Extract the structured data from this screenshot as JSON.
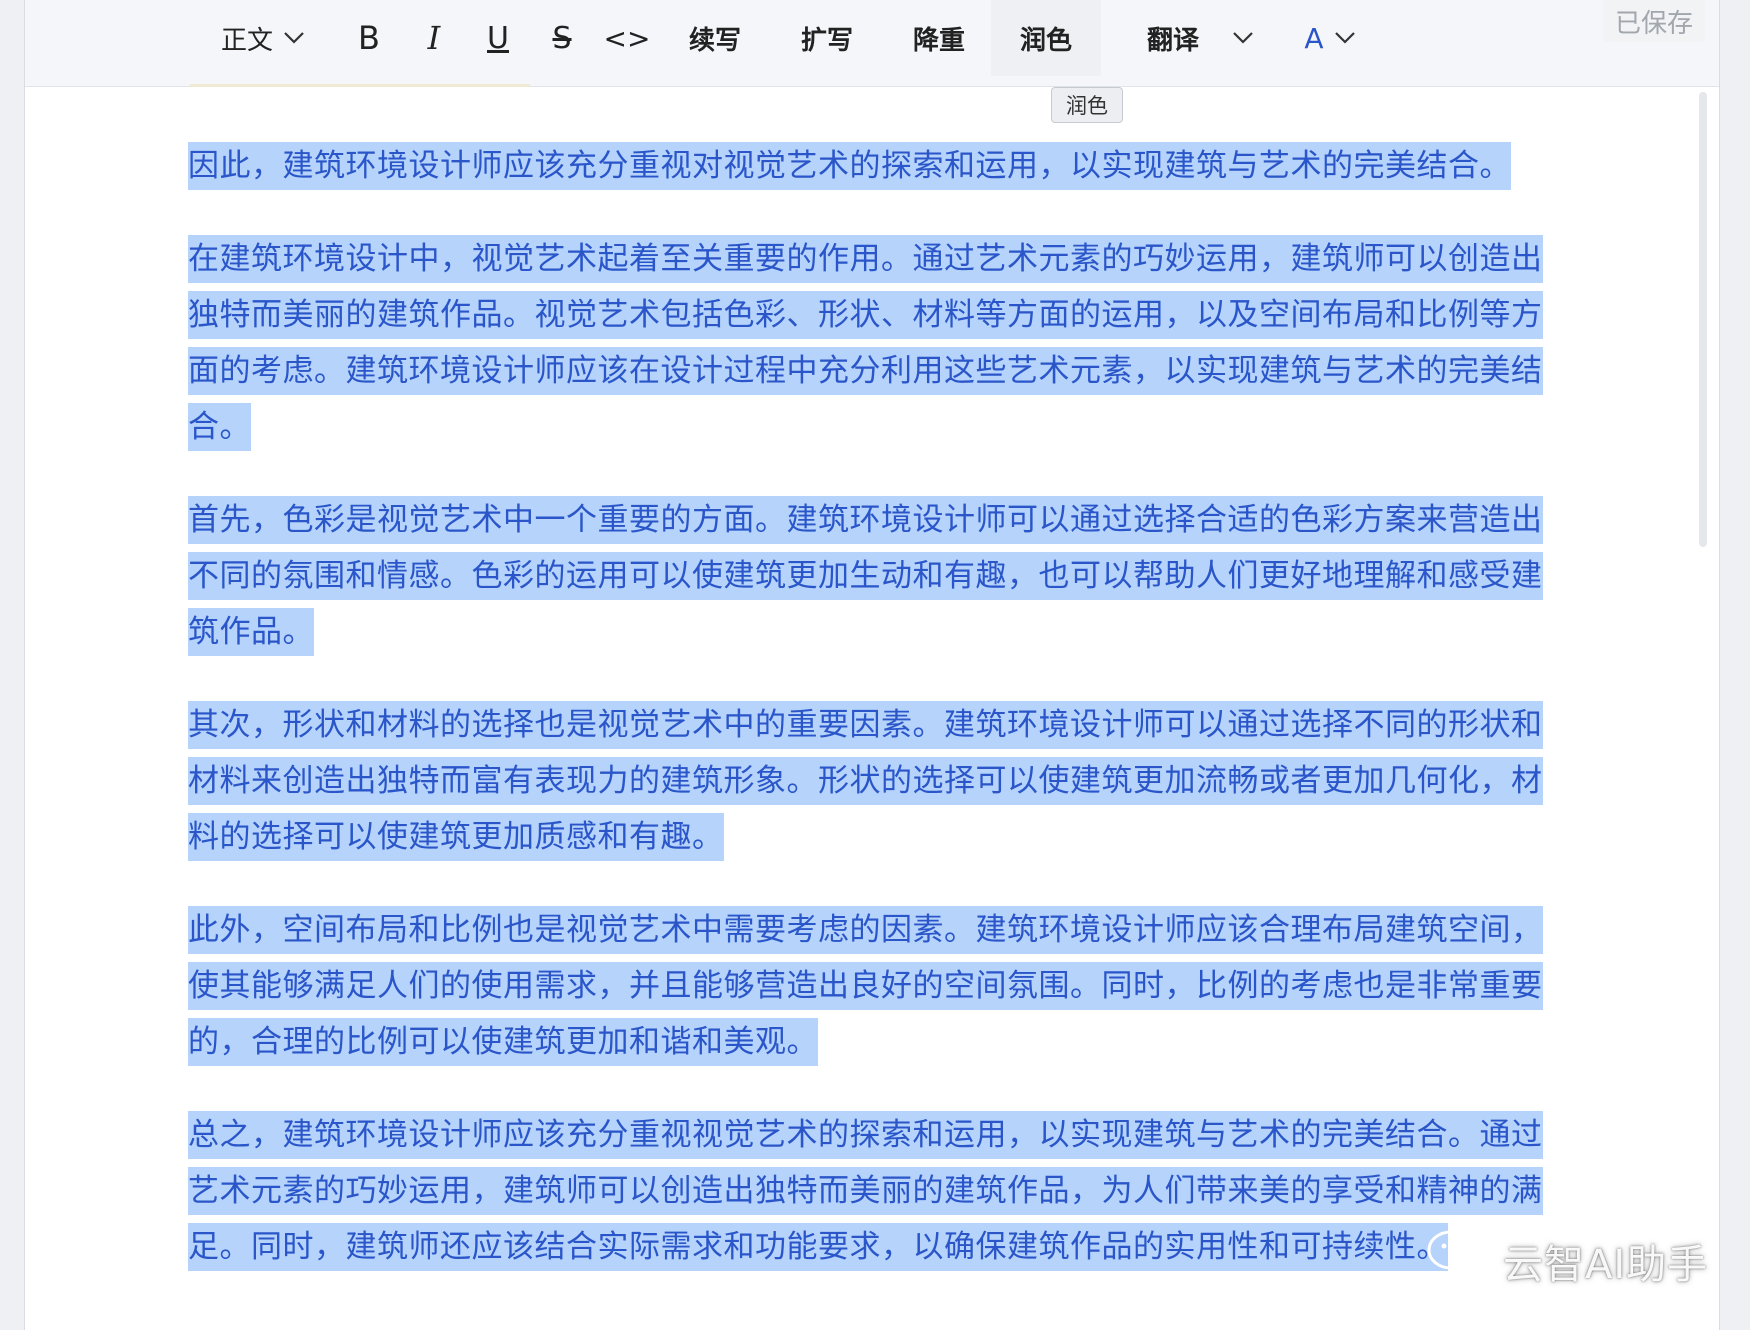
{
  "toolbar": {
    "style_label": "正文",
    "bold_label": "B",
    "italic_label": "I",
    "underline_label": "U",
    "strike_label": "S",
    "code_label": "<>",
    "continue_label": "续写",
    "expand_label": "扩写",
    "dedup_label": "降重",
    "polish_label": "润色",
    "translate_label": "翻译",
    "font_color_label": "A",
    "font_color_accent": "#2a56c9"
  },
  "status": {
    "saved_label": "已保存"
  },
  "tooltip": {
    "text": "润色"
  },
  "document": {
    "paragraphs": [
      "因此，建筑环境设计师应该充分重视对视觉艺术的探索和运用，以实现建筑与艺术的完美结合。",
      "在建筑环境设计中，视觉艺术起着至关重要的作用。通过艺术元素的巧妙运用，建筑师可以创造出独特而美丽的建筑作品。视觉艺术包括色彩、形状、材料等方面的运用，以及空间布局和比例等方面的考虑。建筑环境设计师应该在设计过程中充分利用这些艺术元素，以实现建筑与艺术的完美结合。",
      "首先，色彩是视觉艺术中一个重要的方面。建筑环境设计师可以通过选择合适的色彩方案来营造出不同的氛围和情感。色彩的运用可以使建筑更加生动和有趣，也可以帮助人们更好地理解和感受建筑作品。",
      "其次，形状和材料的选择也是视觉艺术中的重要因素。建筑环境设计师可以通过选择不同的形状和材料来创造出独特而富有表现力的建筑形象。形状的选择可以使建筑更加流畅或者更加几何化，材料的选择可以使建筑更加质感和有趣。",
      "此外，空间布局和比例也是视觉艺术中需要考虑的因素。建筑环境设计师应该合理布局建筑空间，使其能够满足人们的使用需求，并且能够营造出良好的空间氛围。同时，比例的考虑也是非常重要的，合理的比例可以使建筑更加和谐和美观。",
      "总之，建筑环境设计师应该充分重视视觉艺术的探索和运用，以实现建筑与艺术的完美结合。通过艺术元素的巧妙运用，建筑师可以创造出独特而美丽的建筑作品，为人们带来美的享受和精神的满足。同时，建筑师还应该结合实际需求和功能要求，以确保建筑作品的实用性和可持续性。"
    ],
    "selection_color": "#b5d3fb",
    "text_color": "#2a56c9"
  },
  "watermark": {
    "text": "云智AI助手",
    "icon": "wechat-icon"
  }
}
